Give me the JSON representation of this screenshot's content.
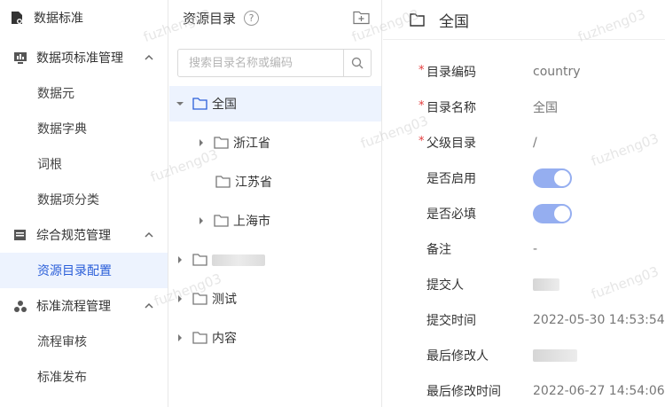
{
  "sidebar": {
    "title": "数据标准",
    "groups": [
      {
        "label": "数据项标准管理",
        "items": [
          "数据元",
          "数据字典",
          "词根",
          "数据项分类"
        ]
      },
      {
        "label": "综合规范管理",
        "items": [
          "资源目录配置"
        ]
      },
      {
        "label": "标准流程管理",
        "items": [
          "流程审核",
          "标准发布"
        ]
      }
    ],
    "active_item": "资源目录配置"
  },
  "tree": {
    "title": "资源目录",
    "help_glyph": "?",
    "search_placeholder": "搜索目录名称或编码",
    "nodes": [
      {
        "label": "全国"
      },
      {
        "label": "浙江省"
      },
      {
        "label": "江苏省"
      },
      {
        "label": "上海市"
      },
      {
        "label": ""
      },
      {
        "label": "测试"
      },
      {
        "label": "内容"
      }
    ]
  },
  "detail": {
    "title": "全国",
    "fields": [
      {
        "label": "目录编码",
        "value": "country",
        "required": "*"
      },
      {
        "label": "目录名称",
        "value": "全国",
        "required": "*"
      },
      {
        "label": "父级目录",
        "value": "/",
        "required": "*"
      },
      {
        "label": "是否启用",
        "value": "on"
      },
      {
        "label": "是否必填",
        "value": "on"
      },
      {
        "label": "备注",
        "value": "-"
      },
      {
        "label": "提交人",
        "value": ""
      },
      {
        "label": "提交时间",
        "value": "2022-05-30 14:53:54"
      },
      {
        "label": "最后修改人",
        "value": ""
      },
      {
        "label": "最后修改时间",
        "value": "2022-06-27 14:54:06"
      }
    ]
  },
  "watermark": "fuzheng03",
  "colors": {
    "accent": "#2b5fd9",
    "active_bg": "#edf3fe",
    "toggle_on": "#95aef0",
    "required": "#e23c3c"
  }
}
